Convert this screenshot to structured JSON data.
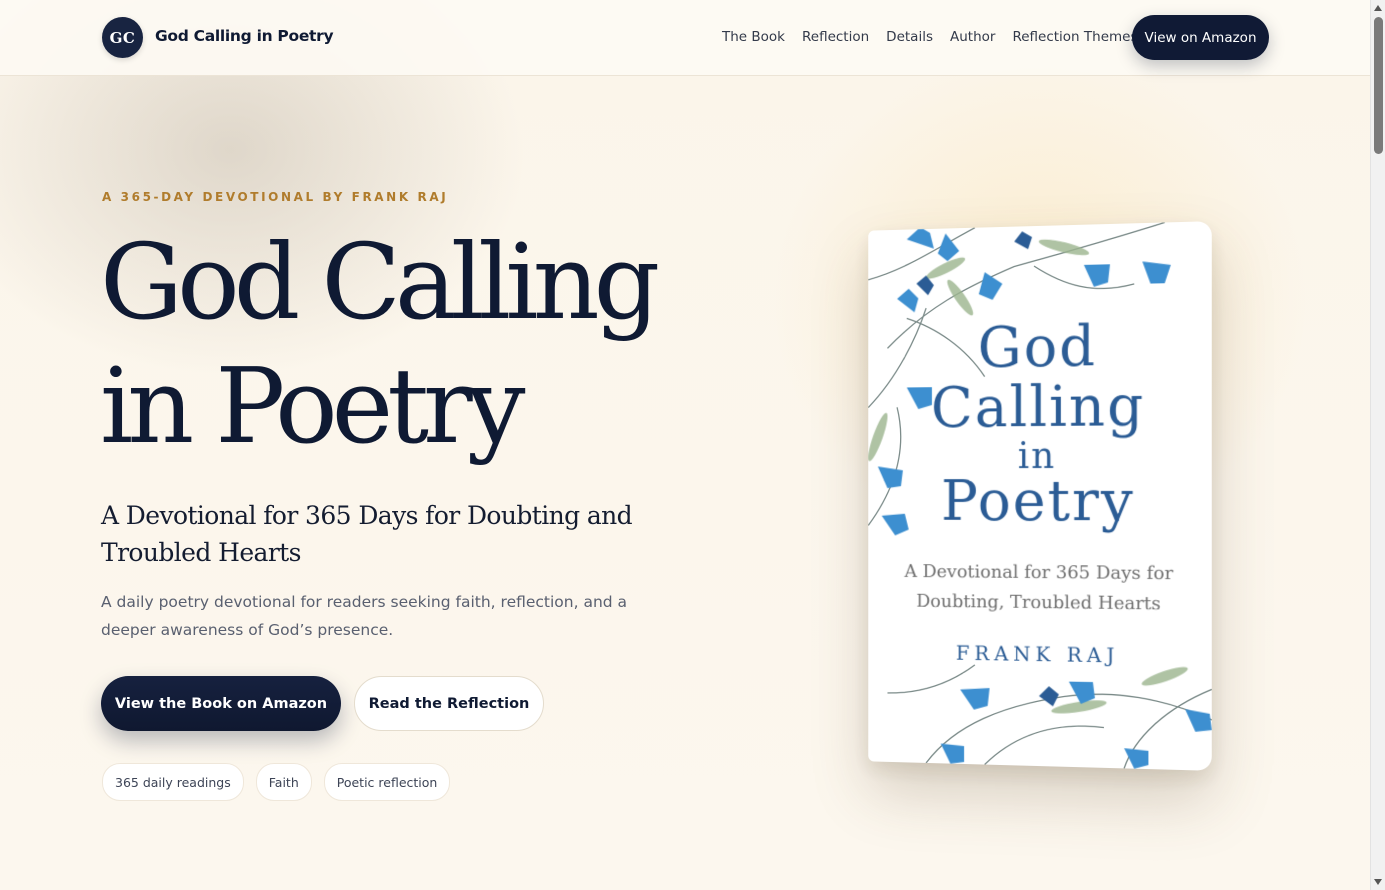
{
  "nav": {
    "logo_initials": "GC",
    "brand": "God Calling in Poetry",
    "links": [
      "The Book",
      "Reflection",
      "Details",
      "Author",
      "Reflection Themes"
    ],
    "cta": "View on Amazon"
  },
  "hero": {
    "eyebrow": "A 365-DAY DEVOTIONAL BY FRANK RAJ",
    "title_line1": "God Calling",
    "title_line2": "in Poetry",
    "subtitle": "A Devotional for 365 Days for Doubting and Troubled Hearts",
    "description": "A daily poetry devotional for readers seeking faith, reflection, and a deeper awareness of God’s presence.",
    "primary_button": "View the Book on Amazon",
    "secondary_button": "Read the Reflection",
    "tags": [
      "365 daily readings",
      "Faith",
      "Poetic reflection"
    ]
  },
  "book_cover": {
    "title_line1": "God",
    "title_line2": "Calling",
    "title_line3": "in",
    "title_line4": "Poetry",
    "subtitle": "A Devotional for 365 Days for Doubting, Troubled Hearts",
    "author": "FRANK RAJ",
    "accent_color": "#2b5c95",
    "flower_color": "#3d8fd0"
  },
  "colors": {
    "primary_dark": "#101a35",
    "eyebrow_gold": "#b07c2c",
    "background": "#fbf6ec"
  }
}
